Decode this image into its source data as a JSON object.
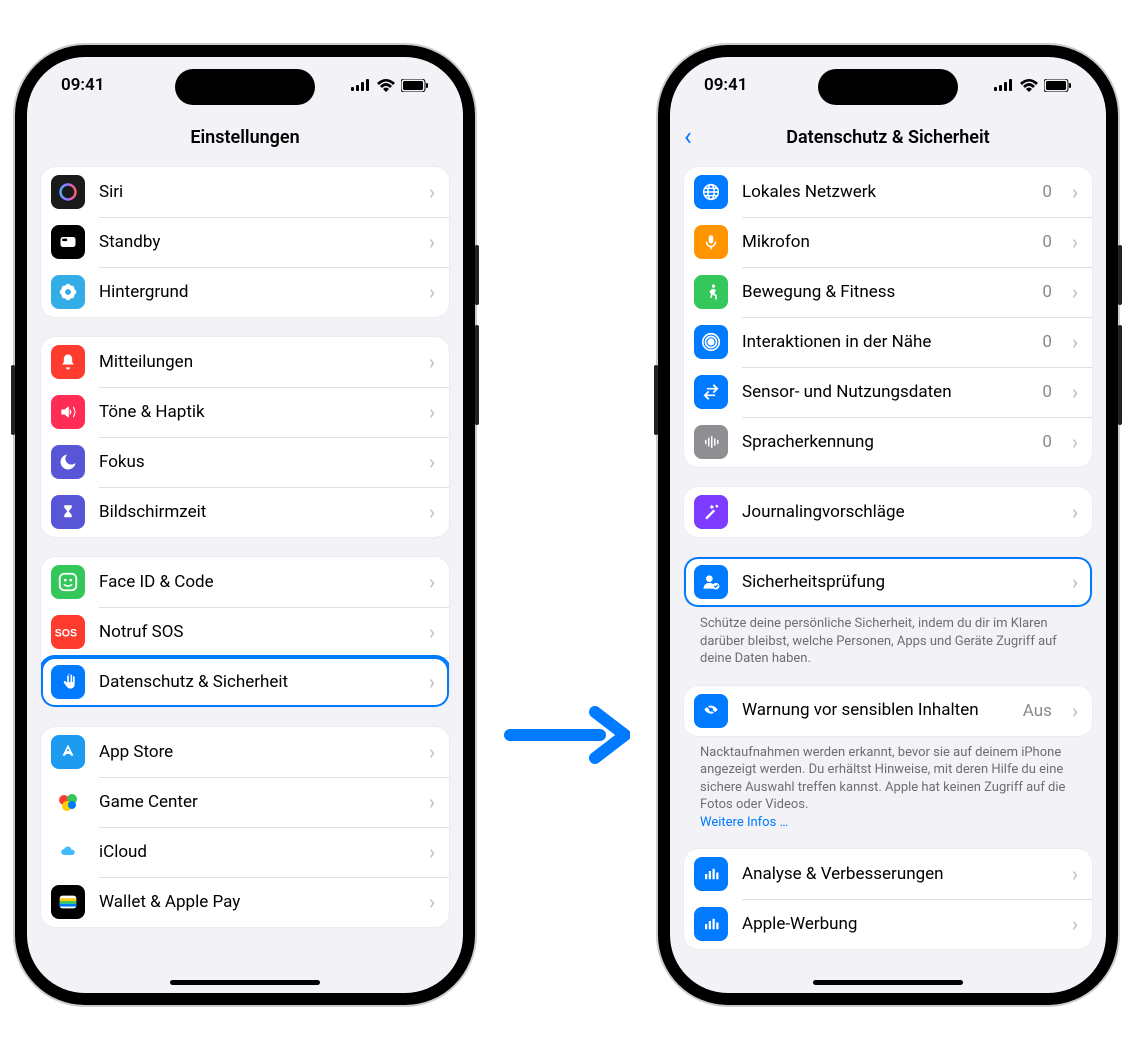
{
  "statusbar": {
    "time": "09:41"
  },
  "left": {
    "title": "Einstellungen",
    "groups": [
      {
        "rows": [
          {
            "id": "siri",
            "icon": "i-siri",
            "glyph": "siri",
            "label": "Siri"
          },
          {
            "id": "standby",
            "icon": "i-standby",
            "glyph": "standby",
            "label": "Standby"
          },
          {
            "id": "wallpaper",
            "icon": "i-wallpaper",
            "glyph": "flower",
            "label": "Hintergrund"
          }
        ]
      },
      {
        "rows": [
          {
            "id": "notif",
            "icon": "i-notif",
            "glyph": "bell",
            "label": "Mitteilungen"
          },
          {
            "id": "sound",
            "icon": "i-sound",
            "glyph": "speaker",
            "label": "Töne & Haptik"
          },
          {
            "id": "focus",
            "icon": "i-focus",
            "glyph": "moon",
            "label": "Fokus"
          },
          {
            "id": "screentime",
            "icon": "i-screentime",
            "glyph": "hourglass",
            "label": "Bildschirmzeit"
          }
        ]
      },
      {
        "rows": [
          {
            "id": "faceid",
            "icon": "i-faceid",
            "glyph": "face",
            "label": "Face ID & Code"
          },
          {
            "id": "sos",
            "icon": "i-sos",
            "glyph": "sos",
            "label": "Notruf SOS"
          },
          {
            "id": "privacy",
            "icon": "i-privacy",
            "glyph": "hand",
            "label": "Datenschutz & Sicherheit",
            "highlight": true
          }
        ]
      },
      {
        "rows": [
          {
            "id": "appstore",
            "icon": "i-appstore",
            "glyph": "appstore",
            "label": "App Store"
          },
          {
            "id": "gamecenter",
            "icon": "i-gamecenter",
            "glyph": "bubbles",
            "label": "Game Center"
          },
          {
            "id": "icloud",
            "icon": "i-icloud",
            "glyph": "cloud",
            "label": "iCloud"
          },
          {
            "id": "wallet",
            "icon": "i-wallet",
            "glyph": "wallet",
            "label": "Wallet & Apple Pay"
          }
        ]
      }
    ]
  },
  "right": {
    "title": "Datenschutz & Sicherheit",
    "groups": [
      {
        "rows": [
          {
            "id": "net",
            "icon": "i-net",
            "glyph": "globe",
            "label": "Lokales Netzwerk",
            "detail": "0"
          },
          {
            "id": "mic",
            "icon": "i-mic",
            "glyph": "mic",
            "label": "Mikrofon",
            "detail": "0"
          },
          {
            "id": "motion",
            "icon": "i-motion",
            "glyph": "runner",
            "label": "Bewegung & Fitness",
            "detail": "0"
          },
          {
            "id": "nearby",
            "icon": "i-nearby",
            "glyph": "radar",
            "label": "Interaktionen in der Nähe",
            "detail": "0"
          },
          {
            "id": "sensor",
            "icon": "i-sensor",
            "glyph": "swap",
            "label": "Sensor- und Nutzungsdaten",
            "detail": "0"
          },
          {
            "id": "speech",
            "icon": "i-speech",
            "glyph": "wave",
            "label": "Spracherkennung",
            "detail": "0"
          }
        ]
      },
      {
        "rows": [
          {
            "id": "journal",
            "icon": "i-journal",
            "glyph": "wand",
            "label": "Journalingvorschläge"
          }
        ]
      },
      {
        "rows": [
          {
            "id": "safety",
            "icon": "i-safety",
            "glyph": "personcheck",
            "label": "Sicherheitsprüfung",
            "highlight": true
          }
        ],
        "footer": "Schütze deine persönliche Sicherheit, indem du dir im Klaren darüber bleibst, welche Personen, Apps und Geräte Zugriff auf deine Daten haben."
      },
      {
        "rows": [
          {
            "id": "sensitive",
            "icon": "i-sensitive",
            "glyph": "eye",
            "label": "Warnung vor sensiblen Inhalten",
            "detail": "Aus"
          }
        ],
        "footer": "Nacktaufnahmen werden erkannt, bevor sie auf deinem iPhone angezeigt werden. Du erhältst Hinweise, mit deren Hilfe du eine sichere Auswahl treffen kannst. Apple hat keinen Zugriff auf die Fotos oder Videos.",
        "footerLink": "Weitere Infos …"
      },
      {
        "rows": [
          {
            "id": "analytics",
            "icon": "i-analytics",
            "glyph": "bars",
            "label": "Analyse & Verbesserungen"
          },
          {
            "id": "ads",
            "icon": "i-ads",
            "glyph": "bars",
            "label": "Apple-Werbung"
          }
        ]
      }
    ]
  }
}
